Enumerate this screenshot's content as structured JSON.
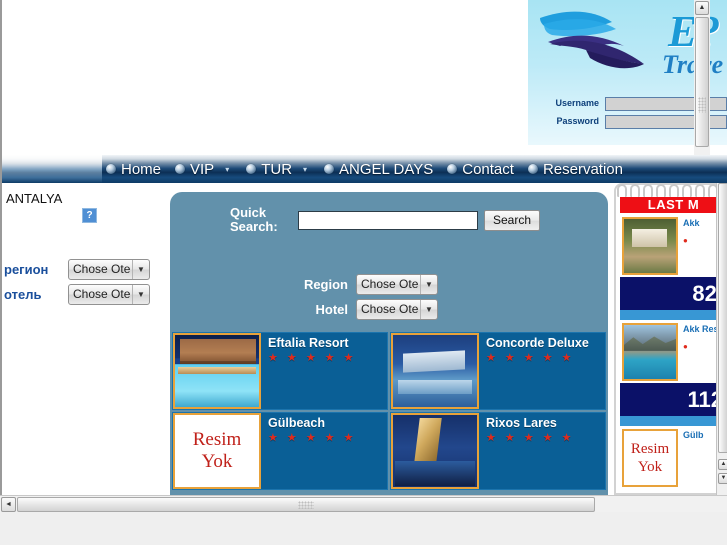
{
  "header": {
    "logo_text_main": "E?",
    "logo_text_sub": "Trave",
    "username_label": "Username",
    "password_label": "Password",
    "username_value": "",
    "password_value": ""
  },
  "nav": {
    "items": [
      {
        "label": "Home",
        "bullet": "bullet-icon",
        "caret": ""
      },
      {
        "label": "VIP",
        "bullet": "bullet-icon",
        "caret": "▾"
      },
      {
        "label": "TUR",
        "bullet": "bullet-icon",
        "caret": "▾"
      },
      {
        "label": "ANGEL DAYS",
        "bullet": "bullet-icon",
        "caret": ""
      },
      {
        "label": "Contact",
        "bullet": "bullet-icon",
        "caret": ""
      },
      {
        "label": "Reservation",
        "bullet": "bullet-icon",
        "caret": ""
      }
    ]
  },
  "sidebar": {
    "title": "ANTALYA",
    "broken_image_icon": "broken-image-icon",
    "broken_image_glyph": "?",
    "region_label": "регион",
    "region_value": "Chose Ote",
    "hotel_label": "отель",
    "hotel_value": "Chose Ote",
    "dropdown_arrow": "▼"
  },
  "search": {
    "quick_label": "Quick Search:",
    "input_value": "",
    "input_placeholder": "",
    "button_label": "Search",
    "region_label": "Region",
    "region_value": "Chose Ote",
    "hotel_label": "Hotel",
    "hotel_value": "Chose Ote",
    "dropdown_arrow": "▼"
  },
  "hotels": [
    {
      "name": "Eftalia Resort",
      "stars": "★ ★ ★ ★ ★",
      "has_image": true,
      "noimg_line1": "",
      "noimg_line2": ""
    },
    {
      "name": "Concorde Deluxe",
      "stars": "★ ★ ★ ★ ★",
      "has_image": true,
      "noimg_line1": "",
      "noimg_line2": ""
    },
    {
      "name": "Gülbeach",
      "stars": "★ ★ ★ ★ ★",
      "has_image": false,
      "noimg_line1": "Resim",
      "noimg_line2": "Yok"
    },
    {
      "name": "Rixos Lares",
      "stars": "★ ★ ★ ★ ★",
      "has_image": true,
      "noimg_line1": "",
      "noimg_line2": ""
    }
  ],
  "last_minute": {
    "banner": "LAST M",
    "items": [
      {
        "name": "Akk",
        "sub": "●",
        "price": "82.",
        "has_image": true,
        "noimg_line1": "",
        "noimg_line2": ""
      },
      {
        "name": "Akk Res",
        "sub": "●",
        "price": "112",
        "has_image": true,
        "noimg_line1": "",
        "noimg_line2": ""
      },
      {
        "name": "Gülb",
        "sub": "",
        "price": "",
        "has_image": false,
        "noimg_line1": "Resim",
        "noimg_line2": "Yok"
      }
    ]
  },
  "scrollbars": {
    "left_arrow": "◄",
    "right_arrow": "►",
    "up_arrow": "▲",
    "down_arrow": "▼"
  },
  "colors": {
    "nav_dark": "#0c2f55",
    "panel_blue": "#6291ab",
    "card_blue": "#0a5f96",
    "star_red": "#e02b1d",
    "banner_red": "#ee0f15",
    "price_navy": "#0b1168",
    "accent_orange": "#e8a23a",
    "link_blue": "#1a4f9c"
  }
}
